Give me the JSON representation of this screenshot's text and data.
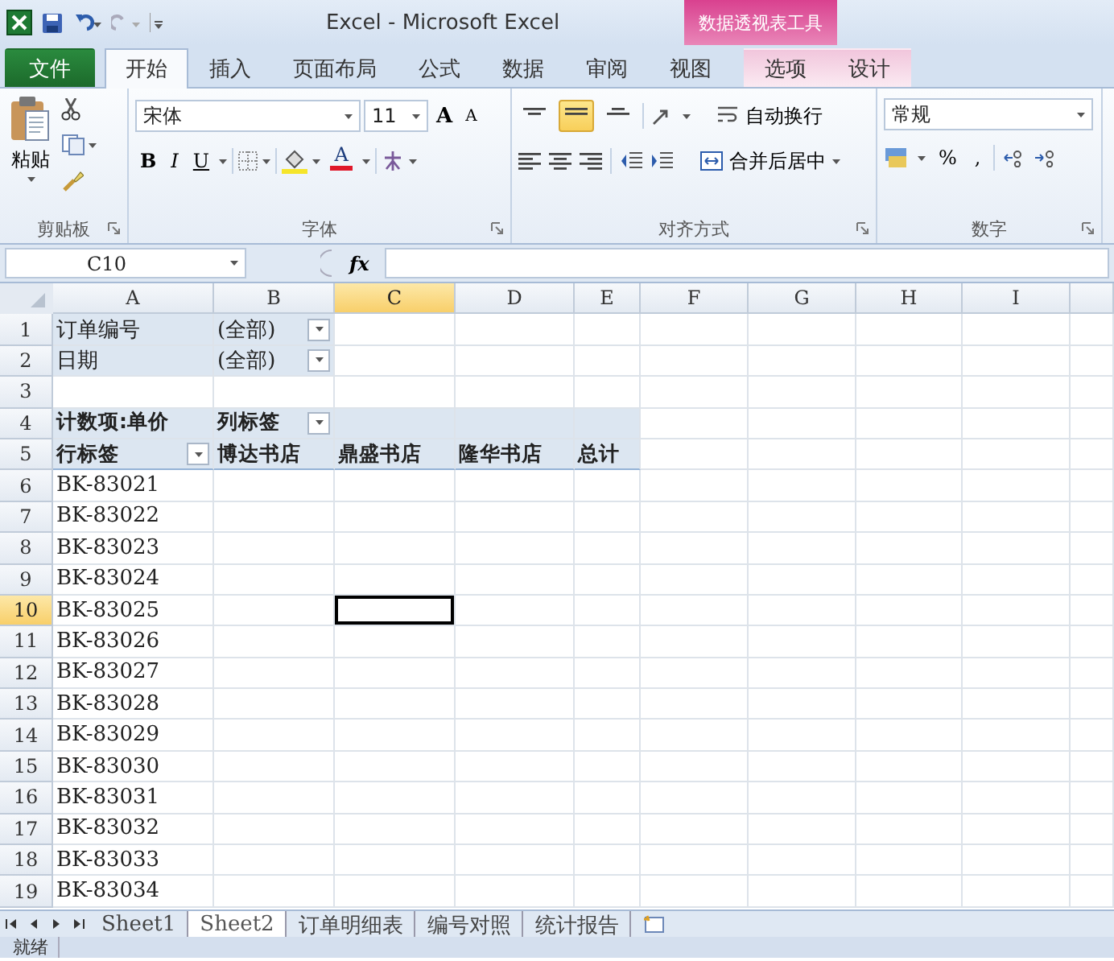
{
  "title_bar": {
    "title": "Excel - Microsoft Excel",
    "context_group": "数据透视表工具"
  },
  "ribbon_tabs": [
    {
      "label": "文件",
      "kind": "file",
      "selected": false
    },
    {
      "label": "开始",
      "kind": "normal",
      "selected": true
    },
    {
      "label": "插入",
      "kind": "normal",
      "selected": false
    },
    {
      "label": "页面布局",
      "kind": "normal",
      "selected": false
    },
    {
      "label": "公式",
      "kind": "normal",
      "selected": false
    },
    {
      "label": "数据",
      "kind": "normal",
      "selected": false
    },
    {
      "label": "审阅",
      "kind": "normal",
      "selected": false
    },
    {
      "label": "视图",
      "kind": "normal",
      "selected": false
    },
    {
      "label": "选项",
      "kind": "contextual",
      "selected": false
    },
    {
      "label": "设计",
      "kind": "contextual",
      "selected": false
    }
  ],
  "ribbon": {
    "groups": [
      {
        "kind": "clipboard",
        "label": "剪贴板",
        "paste": "粘贴"
      },
      {
        "kind": "font",
        "label": "字体",
        "font": "宋体",
        "size": "11",
        "grow": "A",
        "shrink": "A",
        "bold": "B",
        "italic": "I",
        "underline": "U",
        "font_color": "A"
      },
      {
        "kind": "alignment",
        "label": "对齐方式",
        "valign": [
          {
            "selected": false
          },
          {
            "selected": true
          },
          {
            "selected": false
          }
        ],
        "wrap": "自动换行",
        "merge": "合并后居中"
      },
      {
        "kind": "number",
        "label": "数字",
        "format": "常规",
        "percent": "%",
        "comma": ","
      }
    ]
  },
  "formula_bar": {
    "name_box": "C10",
    "fx": "fx"
  },
  "grid": {
    "columns": [
      {
        "label": "A",
        "selected": false
      },
      {
        "label": "B",
        "selected": false
      },
      {
        "label": "C",
        "selected": true
      },
      {
        "label": "D",
        "selected": false
      },
      {
        "label": "E",
        "selected": false
      },
      {
        "label": "F",
        "selected": false
      },
      {
        "label": "G",
        "selected": false
      },
      {
        "label": "H",
        "selected": false
      },
      {
        "label": "I",
        "selected": false
      }
    ],
    "rows": [
      {
        "number": "1",
        "selected": false,
        "cells": [
          {
            "text": "订单编号",
            "kind": "filter",
            "dropdown": false,
            "selected": false
          },
          {
            "text": "(全部)",
            "kind": "filter",
            "dropdown": true,
            "selected": false
          }
        ]
      },
      {
        "number": "2",
        "selected": false,
        "cells": [
          {
            "text": "日期",
            "kind": "filter",
            "dropdown": false,
            "selected": false
          },
          {
            "text": "(全部)",
            "kind": "filter",
            "dropdown": true,
            "selected": false
          }
        ]
      },
      {
        "number": "3",
        "selected": false,
        "cells": []
      },
      {
        "number": "4",
        "selected": false,
        "cells": [
          {
            "text": "计数项:单价",
            "kind": "header",
            "dropdown": false,
            "selected": false
          },
          {
            "text": "列标签",
            "kind": "header",
            "dropdown": true,
            "selected": false
          },
          {
            "kind": "header",
            "dropdown": false,
            "selected": false
          },
          {
            "kind": "header",
            "dropdown": false,
            "selected": false
          },
          {
            "kind": "header",
            "dropdown": false,
            "selected": false
          }
        ]
      },
      {
        "number": "5",
        "selected": false,
        "cells": [
          {
            "text": "行标签",
            "kind": "header",
            "dropdown": true,
            "selected": false
          },
          {
            "text": "博达书店",
            "kind": "header",
            "dropdown": false,
            "selected": false
          },
          {
            "text": "鼎盛书店",
            "kind": "header",
            "dropdown": false,
            "selected": false
          },
          {
            "text": "隆华书店",
            "kind": "header",
            "dropdown": false,
            "selected": false
          },
          {
            "text": "总计",
            "kind": "header",
            "dropdown": false,
            "selected": false
          }
        ]
      },
      {
        "number": "6",
        "selected": false,
        "cells": [
          {
            "text": "BK-83021",
            "kind": "item",
            "dropdown": false,
            "selected": false
          }
        ]
      },
      {
        "number": "7",
        "selected": false,
        "cells": [
          {
            "text": "BK-83022",
            "kind": "item",
            "dropdown": false,
            "selected": false
          }
        ]
      },
      {
        "number": "8",
        "selected": false,
        "cells": [
          {
            "text": "BK-83023",
            "kind": "item",
            "dropdown": false,
            "selected": false
          }
        ]
      },
      {
        "number": "9",
        "selected": false,
        "cells": [
          {
            "text": "BK-83024",
            "kind": "item",
            "dropdown": false,
            "selected": false
          }
        ]
      },
      {
        "number": "10",
        "selected": true,
        "cells": [
          {
            "text": "BK-83025",
            "kind": "item",
            "dropdown": false,
            "selected": false
          },
          {
            "kind": "plain",
            "dropdown": false,
            "selected": false
          },
          {
            "kind": "plain",
            "dropdown": false,
            "selected": true
          }
        ]
      },
      {
        "number": "11",
        "selected": false,
        "cells": [
          {
            "text": "BK-83026",
            "kind": "item",
            "dropdown": false,
            "selected": false
          }
        ]
      },
      {
        "number": "12",
        "selected": false,
        "cells": [
          {
            "text": "BK-83027",
            "kind": "item",
            "dropdown": false,
            "selected": false
          }
        ]
      },
      {
        "number": "13",
        "selected": false,
        "cells": [
          {
            "text": "BK-83028",
            "kind": "item",
            "dropdown": false,
            "selected": false
          }
        ]
      },
      {
        "number": "14",
        "selected": false,
        "cells": [
          {
            "text": "BK-83029",
            "kind": "item",
            "dropdown": false,
            "selected": false
          }
        ]
      },
      {
        "number": "15",
        "selected": false,
        "cells": [
          {
            "text": "BK-83030",
            "kind": "item",
            "dropdown": false,
            "selected": false
          }
        ]
      },
      {
        "number": "16",
        "selected": false,
        "cells": [
          {
            "text": "BK-83031",
            "kind": "item",
            "dropdown": false,
            "selected": false
          }
        ]
      },
      {
        "number": "17",
        "selected": false,
        "cells": [
          {
            "text": "BK-83032",
            "kind": "item",
            "dropdown": false,
            "selected": false
          }
        ]
      },
      {
        "number": "18",
        "selected": false,
        "cells": [
          {
            "text": "BK-83033",
            "kind": "item",
            "dropdown": false,
            "selected": false
          }
        ]
      },
      {
        "number": "19",
        "selected": false,
        "cells": [
          {
            "text": "BK-83034",
            "kind": "item",
            "dropdown": false,
            "selected": false
          }
        ]
      }
    ]
  },
  "sheet_tabs": [
    {
      "label": "Sheet1",
      "selected": false
    },
    {
      "label": "Sheet2",
      "selected": true
    },
    {
      "label": "订单明细表",
      "selected": false
    },
    {
      "label": "编号对照",
      "selected": false
    },
    {
      "label": "统计报告",
      "selected": false
    }
  ],
  "status_bar": {
    "text": "就绪"
  }
}
